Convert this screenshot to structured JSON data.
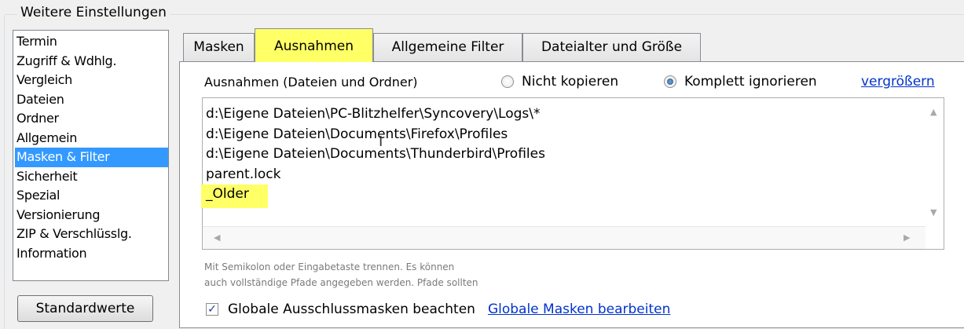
{
  "group": {
    "title": "Weitere Einstellungen"
  },
  "sidebar": {
    "items": [
      {
        "label": "Termin"
      },
      {
        "label": "Zugriff & Wdhlg."
      },
      {
        "label": "Vergleich"
      },
      {
        "label": "Dateien"
      },
      {
        "label": "Ordner"
      },
      {
        "label": "Allgemein"
      },
      {
        "label": "Masken & Filter"
      },
      {
        "label": "Sicherheit"
      },
      {
        "label": "Spezial"
      },
      {
        "label": "Versionierung"
      },
      {
        "label": "ZIP & Verschlüsslg."
      },
      {
        "label": "Information"
      }
    ],
    "selected": "Masken & Filter",
    "default_button": "Standardwerte"
  },
  "tabs": [
    {
      "label": "Masken"
    },
    {
      "label": "Ausnahmen"
    },
    {
      "label": "Allgemeine Filter"
    },
    {
      "label": "Dateialter und Größe"
    }
  ],
  "active_tab": "Ausnahmen",
  "panel": {
    "exceptions_label": "Ausnahmen (Dateien und Ordner)",
    "radio_not_copy": "Nicht kopieren",
    "radio_ignore": "Komplett ignorieren",
    "radio_selected": "Komplett ignorieren",
    "enlarge_link": "vergrößern",
    "memo_lines": [
      "d:\\Eigene Dateien\\PC-Blitzhelfer\\Syncovery\\Logs\\*",
      "d:\\Eigene Dateien\\Documents\\Firefox\\Profiles",
      "d:\\Eigene Dateien\\Documents\\Thunderbird\\Profiles",
      "parent.lock",
      "_Older"
    ],
    "hint_line1": "Mit Semikolon oder Eingabetaste trennen. Es können",
    "hint_line2": "auch vollständige Pfade angegeben werden. Pfade sollten",
    "global_masks_checkbox": "Globale Ausschlussmasken beachten",
    "global_masks_checked": true,
    "edit_global_masks_link": "Globale Masken bearbeiten"
  },
  "colors": {
    "highlight": "#ffff66",
    "selection": "#3399ff",
    "link": "#0033cc"
  }
}
